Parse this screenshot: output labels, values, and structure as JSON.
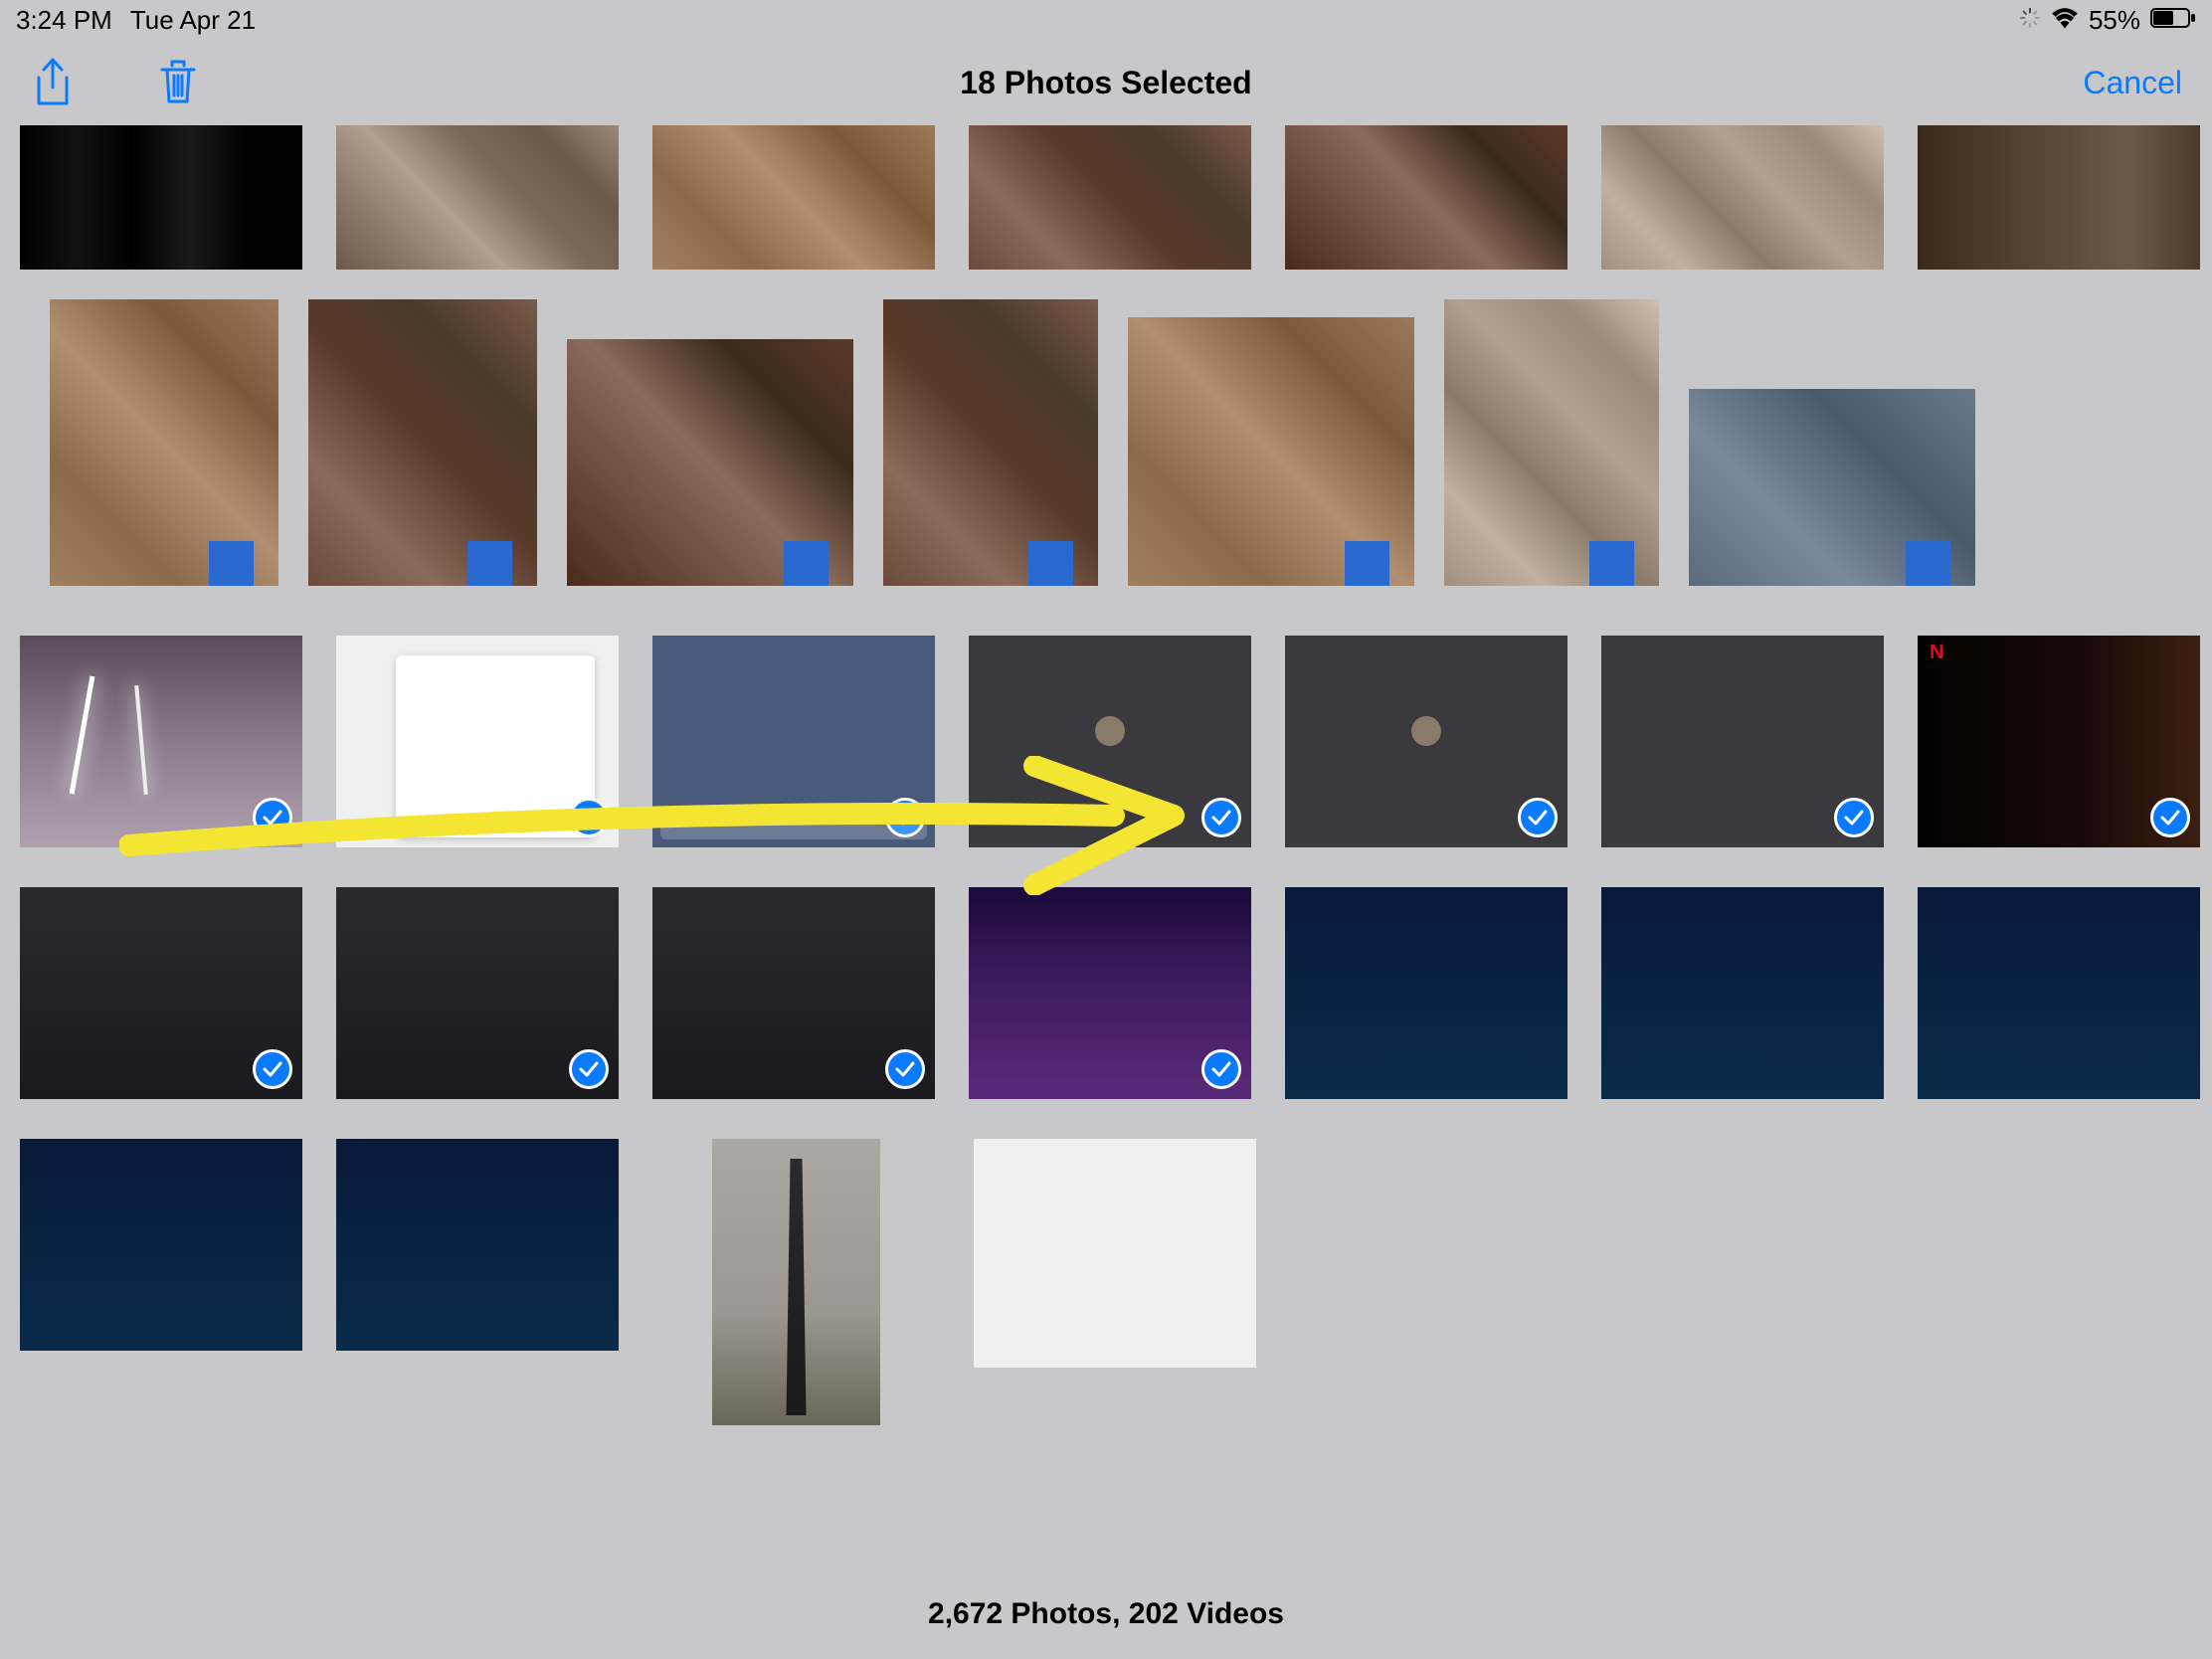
{
  "status": {
    "time": "3:24 PM",
    "date": "Tue Apr 21",
    "battery_pct": "55%"
  },
  "nav": {
    "title": "18 Photos Selected",
    "cancel": "Cancel"
  },
  "footer": {
    "summary": "2,672 Photos, 202 Videos"
  },
  "grid": {
    "row1_count": 7,
    "row2_count": 7,
    "row3_selected_count": 7,
    "row4_selected_count": 4
  },
  "icons": {
    "share": "share-icon",
    "trash": "trash-icon",
    "loading": "loading-icon",
    "wifi": "wifi-icon",
    "battery": "battery-icon"
  }
}
